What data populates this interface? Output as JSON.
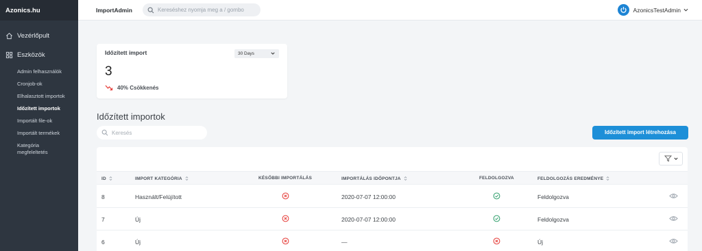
{
  "brand": "Azonics.hu",
  "sidebar": {
    "main": [
      {
        "label": "Vezérlőpult",
        "icon": "home-icon"
      },
      {
        "label": "Eszközök",
        "icon": "grid-icon"
      }
    ],
    "sub": [
      {
        "label": "Admin felhasználók",
        "active": false
      },
      {
        "label": "Cronjob-ok",
        "active": false
      },
      {
        "label": "Elhalasztott importok",
        "active": false
      },
      {
        "label": "Időzített importok",
        "active": true
      },
      {
        "label": "Importált file-ok",
        "active": false
      },
      {
        "label": "Importált termékek",
        "active": false
      }
    ],
    "sub_multiline": {
      "line1": "Kategória",
      "line2": "megfeleltetés"
    }
  },
  "topbar": {
    "app_name": "ImportAdmin",
    "search_placeholder": "Kereséshez nyomja meg a / gombo",
    "user_name": "AzonicsTestAdmin"
  },
  "stat_card": {
    "title": "Időzített import",
    "period": "30 Days",
    "value": "3",
    "trend": "40% Csökkenés",
    "trend_color": "#e53935"
  },
  "section": {
    "title": "Időzített importok",
    "search_placeholder": "Keresés",
    "create_label": "Időzített import létrehozása"
  },
  "table": {
    "columns": [
      "ID",
      "IMPORT KATEGÓRIA",
      "KÉSŐBBI IMPORTÁLÁS",
      "IMPORTÁLÁS IDŐPONTJA",
      "FELDOLGOZVA",
      "FELDOLGOZÁS EREDMÉNYE"
    ],
    "rows": [
      {
        "id": "8",
        "category": "Használt/Felújított",
        "later": false,
        "time": "2020-07-07 12:00:00",
        "processed": true,
        "result": "Feldolgozva"
      },
      {
        "id": "7",
        "category": "Új",
        "later": false,
        "time": "2020-07-07 12:00:00",
        "processed": true,
        "result": "Feldolgozva"
      },
      {
        "id": "6",
        "category": "Új",
        "later": false,
        "time": "—",
        "processed": false,
        "result": "Új"
      }
    ]
  },
  "colors": {
    "sidebar_bg": "#2e3640",
    "accent": "#1d8fd8",
    "success": "#2e9e6b",
    "error": "#e53935"
  }
}
